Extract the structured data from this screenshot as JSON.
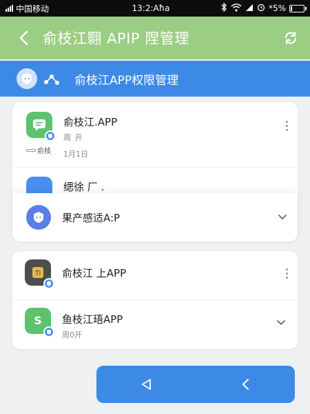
{
  "status_bar": {
    "carrier": "中国移动",
    "time": "13:2:Aħa",
    "battery": "*5%"
  },
  "header": {
    "title": "俞枝江翾 APIP 陧管理"
  },
  "sub_header": {
    "title": "俞枝江APP权限管理"
  },
  "card1": {
    "items": [
      {
        "name": "俞枝江.APP",
        "sub1": "周 开",
        "sub2": "1月1日",
        "tag": "俞枝",
        "icon": "chat-bubble-icon",
        "color": "#5cc26e"
      },
      {
        "name": "缌徐 厂 .",
        "icon": "partial-app-icon",
        "color": "#4a8ff0"
      }
    ],
    "dropdown": {
      "label": "果产感适A:P",
      "icon": "shield-face-icon",
      "color": "#5b7fe3"
    }
  },
  "card2": {
    "items": [
      {
        "name": "俞枝江 上APP",
        "icon": "app-tile-icon",
        "color": "#4d4d4d"
      },
      {
        "name": "鱼枝江珸APP",
        "sub": "周0开",
        "icon": "s-app-icon",
        "color": "#5cc26e"
      }
    ]
  },
  "colors": {
    "header_green": "#9ccd84",
    "accent_blue": "#3d8ae6"
  }
}
